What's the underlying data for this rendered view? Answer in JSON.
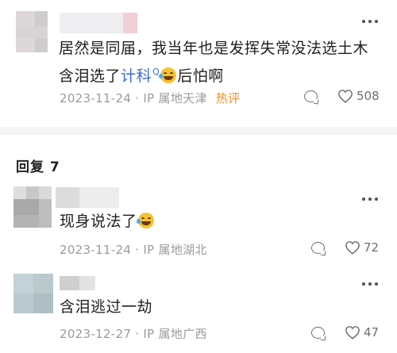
{
  "comments": [
    {
      "content_text_1": "居然是同届，我当年也是发挥失常没法选土木",
      "content_text_2_pre": "含泪选了",
      "content_link": "计科",
      "content_text_2_post": "后怕啊",
      "search_mark": "Q",
      "emoji": "rolling-on-floor-laughing-icon",
      "date": "2023-11-24",
      "location": "· IP 属地天津",
      "badge": "热评",
      "likes": "508"
    }
  ],
  "section": {
    "title": "回复 7"
  },
  "replies": [
    {
      "content_text": "现身说法了",
      "emoji": "rolling-on-floor-laughing-icon",
      "date": "2023-11-24",
      "location": "· IP 属地湖北",
      "likes": "72"
    },
    {
      "content_text": "含泪逃过一劫",
      "date": "2023-12-27",
      "location": "· IP 属地广西",
      "likes": "47"
    }
  ],
  "colors": {
    "link": "#3a6bd1",
    "hot_badge": "#e8912f",
    "meta": "#9b9b9b",
    "emoji": "#f6c233"
  }
}
